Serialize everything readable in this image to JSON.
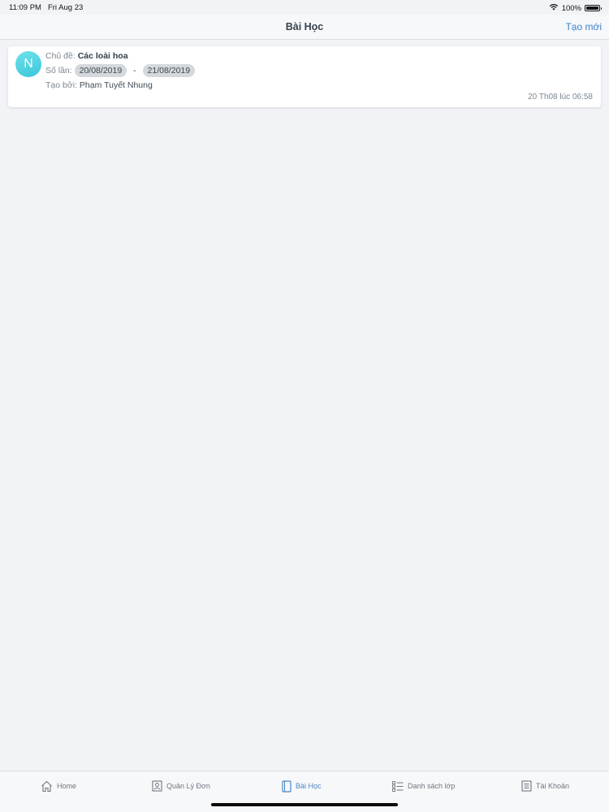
{
  "status_bar": {
    "time": "11:09 PM",
    "date": "Fri Aug 23",
    "battery": "100%"
  },
  "nav": {
    "title": "Bài Học",
    "action_label": "Tạo mới"
  },
  "card": {
    "avatar_letter": "N",
    "topic_label": "Chủ đề:",
    "topic_value": "Các loài hoa",
    "count_label": "Số lần:",
    "start_date": "20/08/2019",
    "separator": "-",
    "end_date": "21/08/2019",
    "creator_label": "Tạo bởi:",
    "creator_value": "Phạm Tuyết Nhung",
    "timestamp": "20 Th08 lúc 06:58"
  },
  "tabs": [
    {
      "label": "Home",
      "icon": "home-icon"
    },
    {
      "label": "Quản Lý Đơn",
      "icon": "contact-card-icon"
    },
    {
      "label": "Bài Học",
      "icon": "book-icon",
      "active": true
    },
    {
      "label": "Danh sách lớp",
      "icon": "list-icon"
    },
    {
      "label": "Tài Khoản",
      "icon": "document-icon"
    }
  ],
  "colors": {
    "accent": "#3c7fc9",
    "avatar": "#39c6dc",
    "background": "#f2f3f7"
  }
}
